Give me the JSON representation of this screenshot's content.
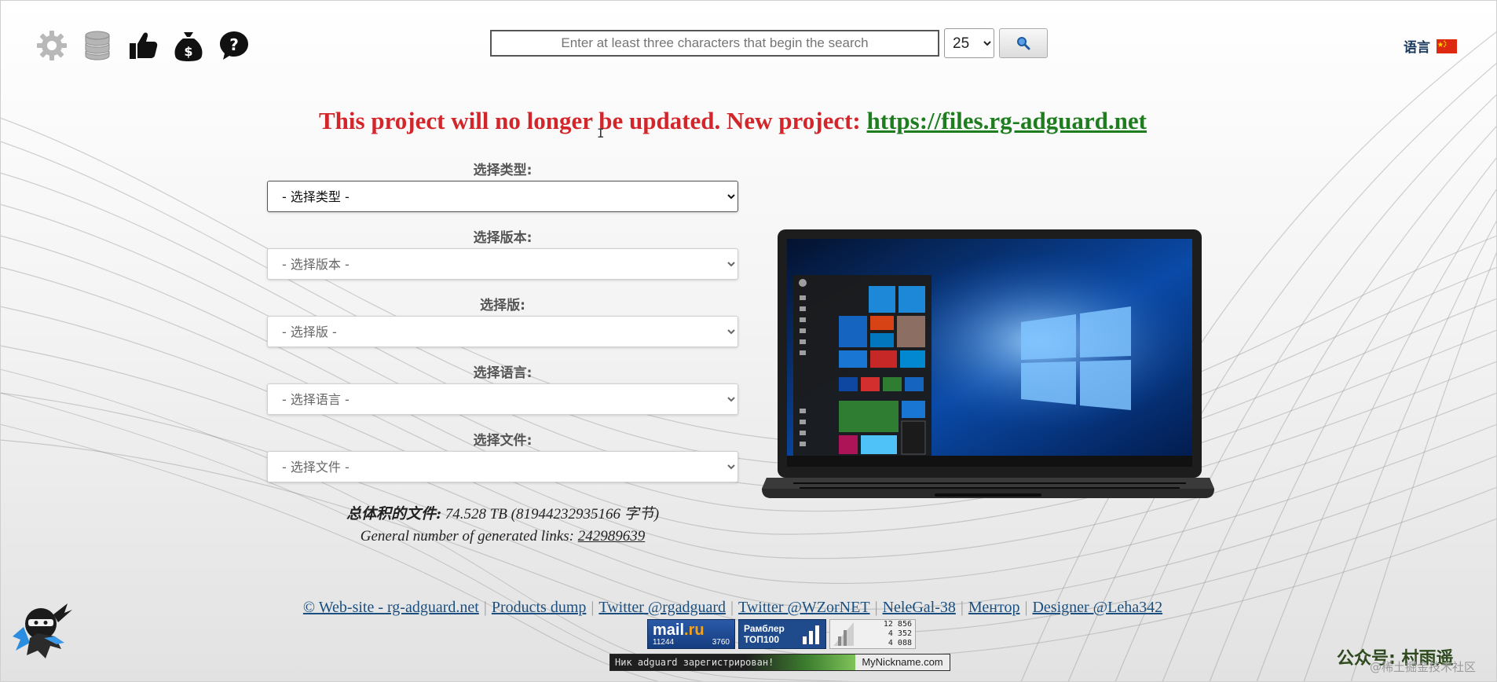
{
  "header": {
    "icons": [
      "gear-icon",
      "database-icon",
      "thumbs-up-icon",
      "money-bag-icon",
      "help-icon"
    ],
    "search": {
      "placeholder": "Enter at least three characters that begin the search",
      "value": "",
      "page_size": "25",
      "page_size_options": [
        "25"
      ]
    },
    "language": {
      "label": "语言",
      "flag": "china-flag-icon"
    }
  },
  "notice": {
    "text": "This project will no longer be updated. New project: ",
    "link": "https://files.rg-adguard.net",
    "text_color": "#d3262b",
    "link_color": "#1e7d1e"
  },
  "form": {
    "fields": [
      {
        "label": "选择类型:",
        "placeholder": "- 选择类型 -"
      },
      {
        "label": "选择版本:",
        "placeholder": "- 选择版本 -"
      },
      {
        "label": "选择版:",
        "placeholder": "- 选择版 -"
      },
      {
        "label": "选择语言:",
        "placeholder": "- 选择语言 -"
      },
      {
        "label": "选择文件:",
        "placeholder": "- 选择文件 -"
      }
    ]
  },
  "stats": {
    "total_label": "总体积的文件:",
    "total_value": " 74.528 TB (81944232935166 字节)",
    "links_label": "General number of generated links: ",
    "links_value": "242989639"
  },
  "footer": {
    "links": [
      "© Web-site - rg-adguard.net",
      "Products dump",
      "Twitter @rgadguard",
      "Twitter @WZorNET",
      "NeleGal-38",
      "Ментор",
      "Designer @Leha342"
    ],
    "separator": "|",
    "badges": {
      "mail_logo_a": "mail",
      "mail_logo_b": ".ru",
      "mail_num1": "11244",
      "mail_num2": "3760",
      "rambler_line1": "Рамблер",
      "rambler_line2": "ТОП100",
      "li_line1": "12 856",
      "li_line2": "4 352",
      "li_line3": "4 088"
    },
    "nick_banner": {
      "left": "Ник adguard зарегистрирован!",
      "right": "MyNickname.com"
    }
  },
  "watermark": {
    "main": "公众号: 村雨遥",
    "sub": "@稀土掘金技术社区"
  }
}
